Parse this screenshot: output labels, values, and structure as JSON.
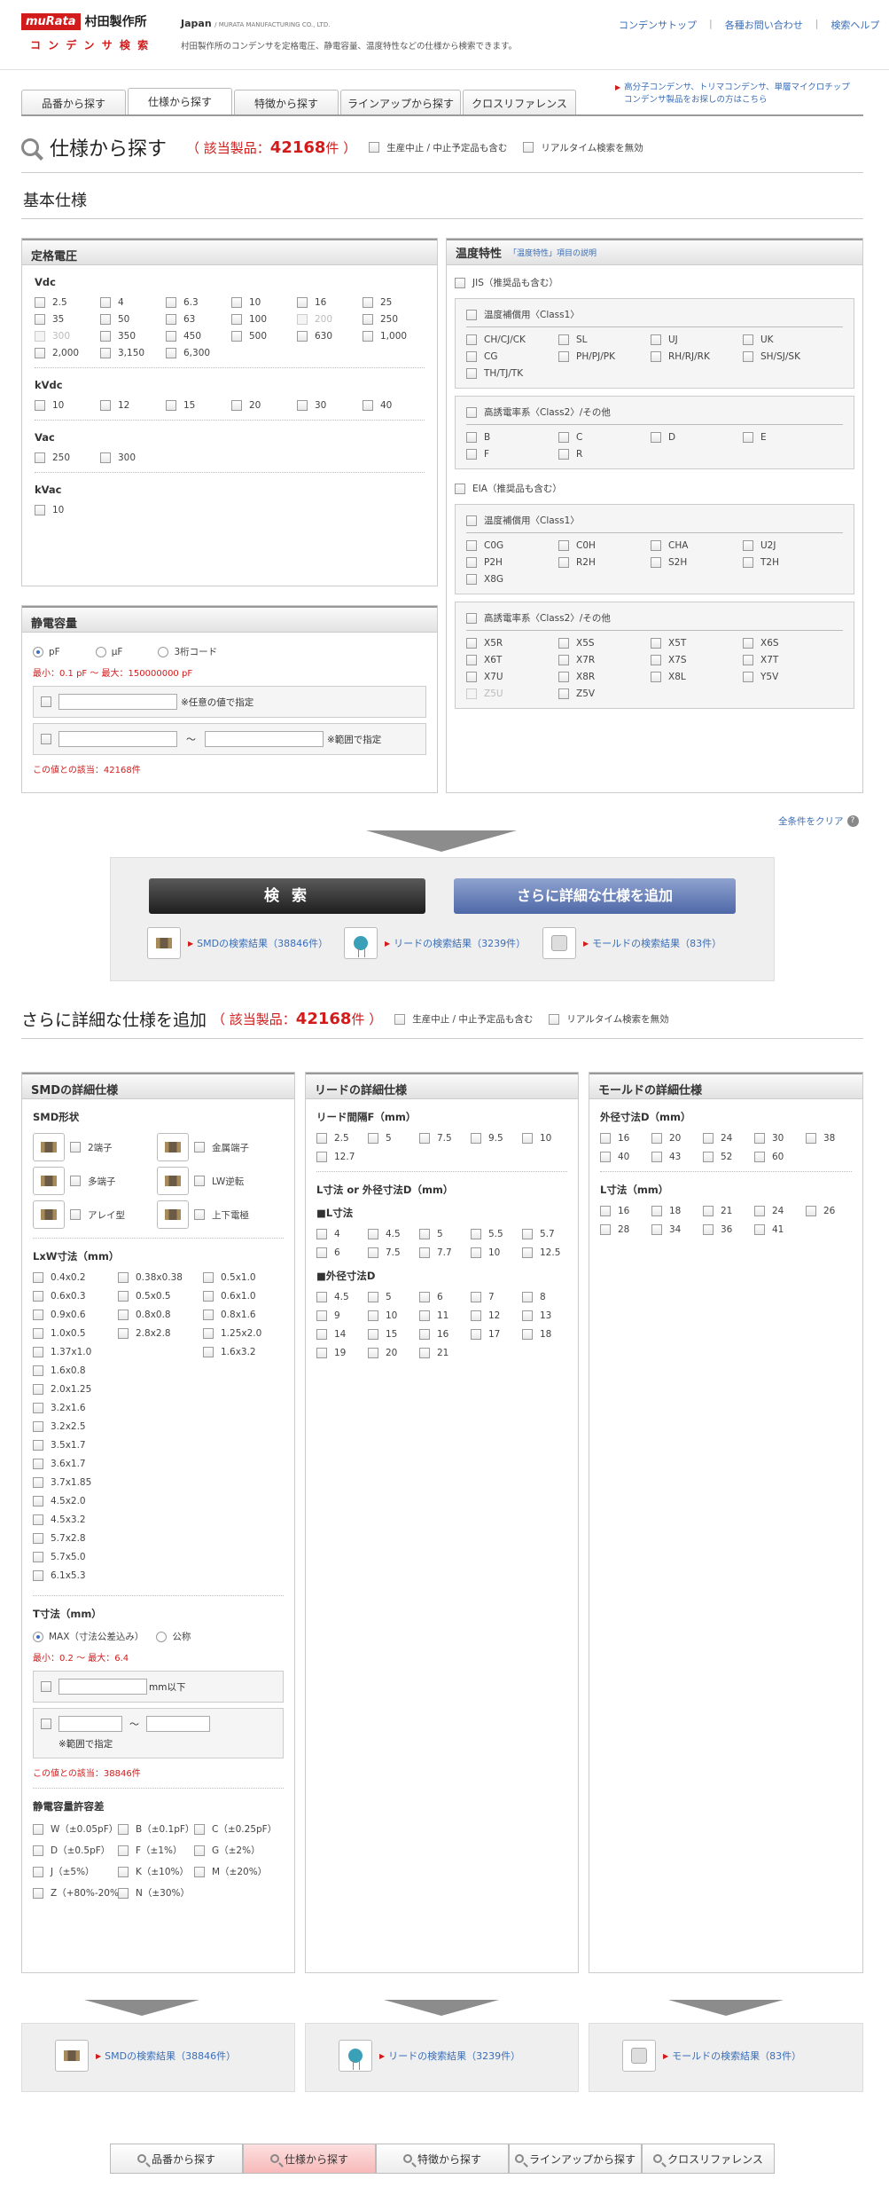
{
  "header": {
    "logo_brand": "muRata",
    "logo_jp": "村田製作所",
    "subtitle": "コ ン デ ン サ 検 索",
    "country": "Japan",
    "country_en": "/ MURATA MANUFACTURING CO., LTD.",
    "desc": "村田製作所のコンデンサを定格電圧、静電容量、温度特性などの仕様から検索できます。",
    "links": [
      "コンデンサトップ",
      "各種お問い合わせ",
      "検索ヘルプ"
    ],
    "promo": [
      "高分子コンデンサ、トリマコンデンサ、単層マイクロチップ",
      "コンデンサ製品をお探しの方はこちら"
    ]
  },
  "tabs": [
    "品番から探す",
    "仕様から探す",
    "特徴から探す",
    "ラインアップから探す",
    "クロスリファレンス"
  ],
  "search": {
    "title": "仕様から探す",
    "count_label": "（ 該当製品：",
    "count": "42168",
    "count_suffix": "件 ）",
    "discontinued": "生産中止 / 中止予定品も含む",
    "realtime": "リアルタイム検索を無効"
  },
  "basic": {
    "title": "基本仕様"
  },
  "voltage": {
    "title": "定格電圧",
    "vdc_label": "Vdc",
    "vdc": [
      "2.5",
      "4",
      "6.3",
      "10",
      "16",
      "25",
      "35",
      "50",
      "63",
      "100",
      "200",
      "250",
      "300",
      "350",
      "450",
      "500",
      "630",
      "1,000",
      "2,000",
      "3,150",
      "6,300"
    ],
    "vdc_disabled": [
      "200",
      "300"
    ],
    "kvdc_label": "kVdc",
    "kvdc": [
      "10",
      "12",
      "15",
      "20",
      "30",
      "40"
    ],
    "vac_label": "Vac",
    "vac": [
      "250",
      "300"
    ],
    "kvac_label": "kVac",
    "kvac": [
      "10"
    ]
  },
  "capacitance": {
    "title": "静電容量",
    "units": [
      "pF",
      "μF",
      "3桁コード"
    ],
    "range": "最小：0.1 pF 〜 最大：150000000 pF",
    "any_value": "※任意の値で指定",
    "range_spec": "※範囲で指定",
    "tilde": "〜",
    "hits": "この値との該当：42168件"
  },
  "temp": {
    "title": "温度特性",
    "link": "「温度特性」項目の説明",
    "jis": "JIS（推奨品も含む）",
    "class1": "温度補償用〈Class1〉",
    "jis_c1": [
      "CH/CJ/CK",
      "SL",
      "UJ",
      "UK",
      "CG",
      "PH/PJ/PK",
      "RH/RJ/RK",
      "SH/SJ/SK",
      "TH/TJ/TK"
    ],
    "class2": "高誘電率系〈Class2〉/その他",
    "jis_c2": [
      "B",
      "C",
      "D",
      "E",
      "F",
      "R"
    ],
    "eia": "EIA（推奨品も含む）",
    "eia_c1": [
      "C0G",
      "C0H",
      "CHA",
      "U2J",
      "P2H",
      "R2H",
      "S2H",
      "T2H",
      "X8G"
    ],
    "eia_c2": [
      "X5R",
      "X5S",
      "X5T",
      "X6S",
      "X6T",
      "X7R",
      "X7S",
      "X7T",
      "X7U",
      "X8R",
      "X8L",
      "Y5V",
      "Z5U",
      "Z5V"
    ],
    "eia_c2_disabled": [
      "Z5U"
    ]
  },
  "clear": "全条件をクリア",
  "buttons": {
    "search": "検 索",
    "detail": "さらに詳細な仕様を追加"
  },
  "results": {
    "smd": "SMDの検索結果（38846件）",
    "lead": "リードの検索結果（3239件）",
    "mold": "モールドの検索結果（83件）"
  },
  "detail": {
    "title": "さらに詳細な仕様を追加"
  },
  "smd": {
    "title": "SMDの詳細仕様",
    "shape_label": "SMD形状",
    "shapes": [
      "2端子",
      "金属端子",
      "多端子",
      "LW逆転",
      "アレイ型",
      "上下電極"
    ],
    "lxw_label": "LxW寸法（mm）",
    "lxw": [
      "0.4x0.2",
      "0.38x0.38",
      "0.5x1.0",
      "0.6x0.3",
      "0.5x0.5",
      "0.6x1.0",
      "0.9x0.6",
      "0.8x0.8",
      "0.8x1.6",
      "1.0x0.5",
      "2.8x2.8",
      "1.25x2.0",
      "1.37x1.0",
      "1.6x3.2",
      "1.6x0.8",
      "2.0x1.25",
      "3.2x1.6",
      "3.2x2.5",
      "3.5x1.7",
      "3.6x1.7",
      "3.7x1.85",
      "4.5x2.0",
      "4.5x3.2",
      "5.7x2.8",
      "5.7x5.0",
      "6.1x5.3"
    ],
    "t_label": "T寸法（mm）",
    "t_opts": [
      "MAX（寸法公差込み）",
      "公称"
    ],
    "t_range": "最小：0.2 〜 最大：6.4",
    "t_below": "mm以下",
    "t_tilde": "〜",
    "t_spec": "※範囲で指定",
    "t_hits": "この値との該当：38846件",
    "tol_label": "静電容量許容差",
    "tol": [
      "W（±0.05pF）",
      "B（±0.1pF）",
      "C（±0.25pF）",
      "D（±0.5pF）",
      "F（±1%）",
      "G（±2%）",
      "J（±5%）",
      "K（±10%）",
      "M（±20%）",
      "Z（+80%-20%）",
      "N（±30%）"
    ]
  },
  "lead": {
    "title": "リードの詳細仕様",
    "pitch_label": "リード間隔F（mm）",
    "pitch": [
      "2.5",
      "5",
      "7.5",
      "9.5",
      "10",
      "12.7"
    ],
    "ld_label": "L寸法 or 外径寸法D（mm）",
    "l_label": "■L寸法",
    "l": [
      "4",
      "4.5",
      "5",
      "5.5",
      "5.7",
      "6",
      "7.5",
      "7.7",
      "10",
      "12.5"
    ],
    "d_label": "■外径寸法D",
    "d": [
      "4.5",
      "5",
      "6",
      "7",
      "8",
      "9",
      "10",
      "11",
      "12",
      "13",
      "14",
      "15",
      "16",
      "17",
      "18",
      "19",
      "20",
      "21"
    ]
  },
  "mold": {
    "title": "モールドの詳細仕様",
    "d_label": "外径寸法D（mm）",
    "d": [
      "16",
      "20",
      "24",
      "30",
      "38",
      "40",
      "43",
      "52",
      "60"
    ],
    "l_label": "L寸法（mm）",
    "l": [
      "16",
      "18",
      "21",
      "24",
      "26",
      "28",
      "34",
      "36",
      "41"
    ]
  },
  "bottom_tabs": [
    "品番から探す",
    "仕様から探す",
    "特徴から探す",
    "ラインアップから探す",
    "クロスリファレンス"
  ]
}
